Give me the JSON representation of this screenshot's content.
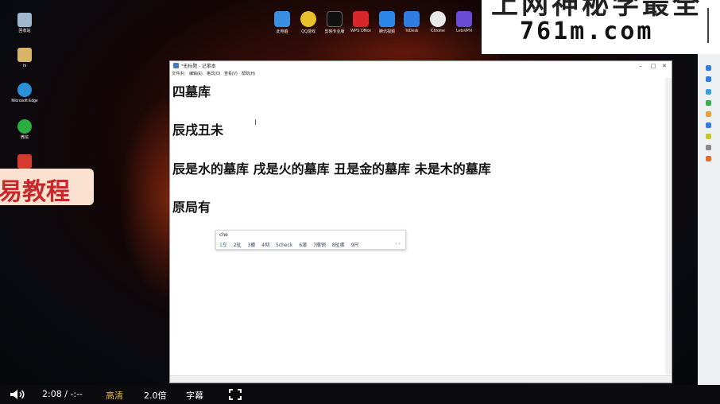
{
  "desktop_icons": [
    {
      "label": "回收站",
      "icon": "recycle-bin-icon",
      "color": "#9fb6cc"
    },
    {
      "label": "hi",
      "icon": "file-icon",
      "color": "#d9b56a"
    },
    {
      "label": "Microsoft Edge",
      "icon": "edge-icon",
      "color": "#2b8fd6"
    },
    {
      "label": "微信",
      "icon": "wechat-icon",
      "color": "#2aae3e"
    },
    {
      "label": "",
      "icon": "app-icon",
      "color": "#d43b2e"
    }
  ],
  "taskbar_icons": [
    {
      "label": "此电脑",
      "icon": "computer-icon",
      "color": "#3b8fe0"
    },
    {
      "label": "QQ游戏",
      "icon": "qq-game-icon",
      "color": "#e9c22b"
    },
    {
      "label": "剪映专业版",
      "icon": "capcut-icon",
      "color": "#111111"
    },
    {
      "label": "WPS Office",
      "icon": "wps-icon",
      "color": "#d8262b"
    },
    {
      "label": "腾讯视频",
      "icon": "tencent-video-icon",
      "color": "#2a86e8"
    },
    {
      "label": "ToDesk",
      "icon": "todesk-icon",
      "color": "#2f7de1"
    },
    {
      "label": "Chrome",
      "icon": "chrome-icon",
      "color": "#e8e8e8"
    },
    {
      "label": "LetsVPN",
      "icon": "letsvpn-icon",
      "color": "#6a4bd6"
    }
  ],
  "watermark": {
    "line1": "上网神秘学最全",
    "line2": "761m.com"
  },
  "banner": {
    "text": "易教程"
  },
  "notepad": {
    "title": "*无标题 - 记事本",
    "menu": [
      "文件(F)",
      "编辑(E)",
      "格式(O)",
      "查看(V)",
      "帮助(H)"
    ],
    "lines": [
      "四墓库",
      "辰戌丑未",
      "辰是水的墓库 戌是火的墓库 丑是金的墓库 未是木的墓库",
      "原局有"
    ]
  },
  "ime": {
    "composition": "che",
    "candidates": [
      "1车",
      "2扯",
      "3撤",
      "4彻",
      "5check",
      "6澈",
      "7撤销",
      "8扯蛋",
      "9尺"
    ]
  },
  "video_controls": {
    "time": "2:08 / -:--",
    "quality": "高清",
    "speed": "2.0倍",
    "subtitle": "字幕"
  },
  "colors": {
    "accent_quality": "#e6b84a",
    "ime_highlight": "#3a6fd8",
    "banner_text": "#c8282b"
  }
}
